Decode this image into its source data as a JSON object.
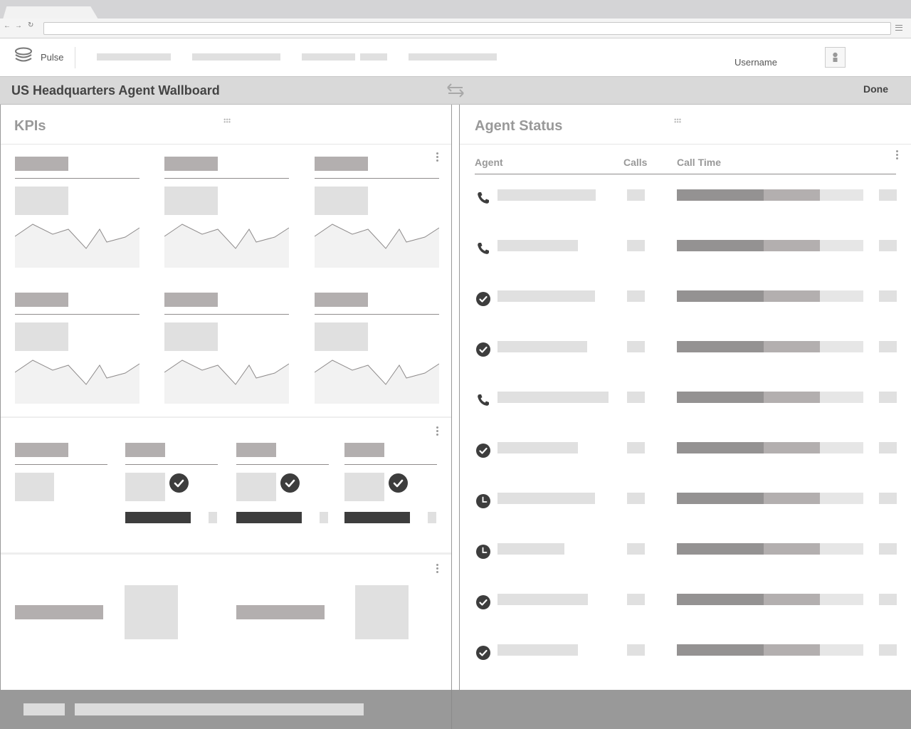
{
  "app": {
    "name": "Pulse"
  },
  "user": {
    "name": "Username"
  },
  "wallboard": {
    "title": "US Headquarters Agent Wallboard",
    "done_label": "Done"
  },
  "kpis": {
    "title": "KPIs"
  },
  "agent_status": {
    "title": "Agent Status",
    "columns": {
      "agent": "Agent",
      "calls": "Calls",
      "call_time": "Call Time"
    },
    "rows": [
      {
        "status": "phone-icon"
      },
      {
        "status": "phone-icon"
      },
      {
        "status": "check-circle-icon"
      },
      {
        "status": "check-circle-icon"
      },
      {
        "status": "phone-icon"
      },
      {
        "status": "check-circle-icon"
      },
      {
        "status": "clock-icon"
      },
      {
        "status": "clock-icon"
      },
      {
        "status": "check-circle-icon"
      },
      {
        "status": "check-circle-icon"
      }
    ]
  },
  "colors": {
    "chrome": "#d4d4d6",
    "header_bar": "#d9d9d9",
    "footer": "#999999",
    "accent_dark": "#3d3d3d"
  }
}
